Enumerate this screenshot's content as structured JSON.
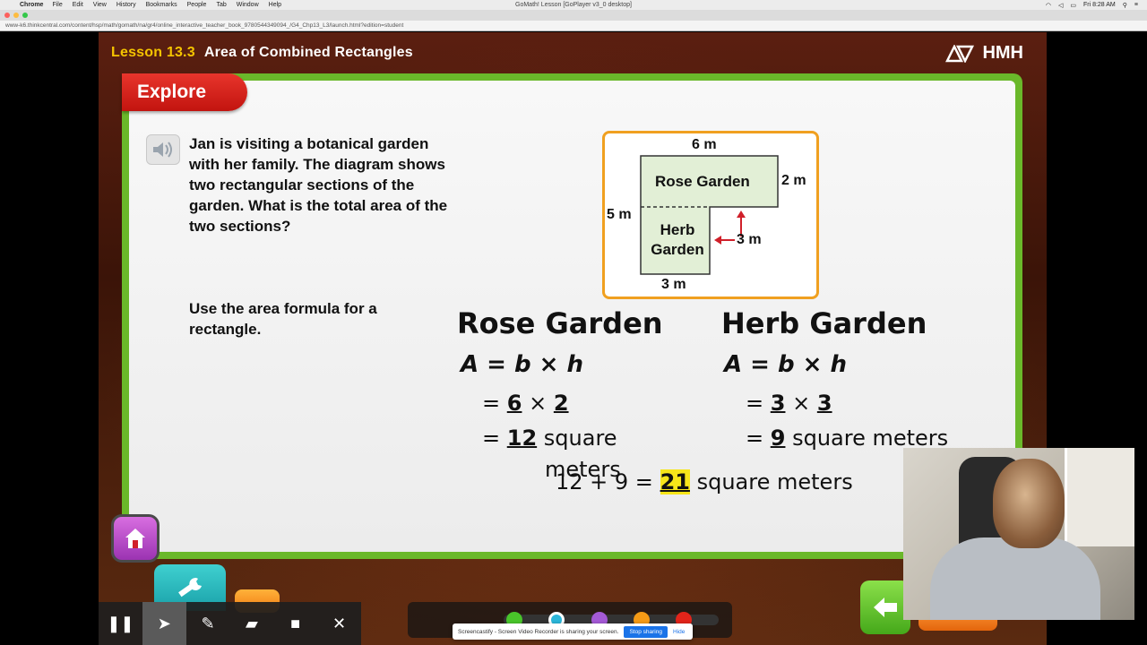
{
  "menubar": {
    "app_name": "Chrome",
    "menus": [
      "File",
      "Edit",
      "View",
      "History",
      "Bookmarks",
      "People",
      "Tab",
      "Window",
      "Help"
    ],
    "window_title": "GoMath! Lesson [GoPlayer v3_0 desktop]",
    "clock": "Fri 8:28 AM"
  },
  "browser": {
    "url": "www-k6.thinkcentral.com/content/hsp/math/gomath/na/gr4/online_interactive_teacher_book_9780544349094_/G4_Chp13_L3/launch.html?edition=student"
  },
  "lesson": {
    "number": "Lesson 13.3",
    "title": "Area of Combined Rectangles",
    "publisher": "HMH",
    "section_tab": "Explore",
    "problem_text": "Jan is visiting a botanical garden with her family. The diagram shows two rectangular sections of the garden. What is the total area of the two sections?",
    "hint_text": "Use the area formula for a rectangle."
  },
  "diagram": {
    "top_label": "6 m",
    "right_label": "2 m",
    "left_label": "5 m",
    "inner_label": "3 m",
    "bottom_label": "3 m",
    "region_1": "Rose Garden",
    "region_2_line1": "Herb",
    "region_2_line2": "Garden"
  },
  "work": {
    "rose_heading": "Rose Garden",
    "herb_heading": "Herb Garden",
    "formula": "A = b × h",
    "rose_step1_eq": "=",
    "rose_b": "6",
    "rose_h": "2",
    "rose_result": "12",
    "rose_units_1": "square",
    "rose_units_2": "meters",
    "herb_step1_eq": "=",
    "herb_b": "3",
    "herb_h": "3",
    "herb_result": "9",
    "herb_units": "square meters",
    "sum_expr": "12 + 9 =",
    "total": "21",
    "total_units": "square meters"
  },
  "screencast": {
    "share_text": "Screencastify - Screen Video Recorder is sharing your screen.",
    "stop_label": "Stop sharing",
    "hide_label": "Hide"
  },
  "colors": {
    "accent_yellow": "#f5c400",
    "explore_red": "#d4231b",
    "panel_green": "#6ab82a",
    "diagram_border": "#f0a020",
    "garden_fill": "#e2efd6",
    "highlight": "#f7e51a"
  }
}
